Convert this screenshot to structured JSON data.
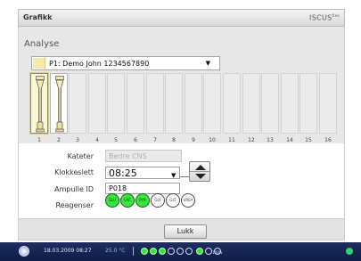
{
  "window": {
    "title": "Grafikk",
    "brand": "ISCUS",
    "brand_suffix": "flex"
  },
  "analyse": {
    "section_label": "Analyse",
    "patient_select": {
      "value": "P1: Demo John 1234567890"
    },
    "slots": [
      {
        "number": "1",
        "state": "selected",
        "has_vial": true
      },
      {
        "number": "2",
        "state": "active",
        "has_vial": true
      },
      {
        "number": "3",
        "state": "empty",
        "has_vial": false
      },
      {
        "number": "4",
        "state": "empty",
        "has_vial": false
      },
      {
        "number": "5",
        "state": "empty",
        "has_vial": false
      },
      {
        "number": "6",
        "state": "empty",
        "has_vial": false
      },
      {
        "number": "7",
        "state": "empty",
        "has_vial": false
      },
      {
        "number": "8",
        "state": "empty",
        "has_vial": false
      },
      {
        "number": "9",
        "state": "empty",
        "has_vial": false
      },
      {
        "number": "10",
        "state": "empty",
        "has_vial": false
      },
      {
        "number": "11",
        "state": "empty",
        "has_vial": false
      },
      {
        "number": "12",
        "state": "empty",
        "has_vial": false
      },
      {
        "number": "13",
        "state": "empty",
        "has_vial": false
      },
      {
        "number": "14",
        "state": "empty",
        "has_vial": false
      },
      {
        "number": "15",
        "state": "empty",
        "has_vial": false
      },
      {
        "number": "16",
        "state": "empty",
        "has_vial": false
      }
    ]
  },
  "form": {
    "kateter_label": "Kateter",
    "kateter_value": "Bedre CNS",
    "klokkeslett_label": "Klokkeslett",
    "klokkeslett_value": "08:25",
    "ampulle_label": "Ampulle ID",
    "ampulle_value": "P018",
    "reagenser_label": "Reagenser",
    "reagents": [
      {
        "code": "GLU",
        "active": true
      },
      {
        "code": "LAC",
        "active": true
      },
      {
        "code": "PYR",
        "active": true
      },
      {
        "code": "GLY",
        "active": false
      },
      {
        "code": "GLT",
        "active": false
      },
      {
        "code": "UREA",
        "active": false
      }
    ]
  },
  "footer": {
    "close_label": "Lukk"
  },
  "taskbar": {
    "datetime": "18.03.2009 08:27",
    "temperature": "25.0 °C",
    "indicators": [
      true,
      true,
      true,
      false,
      false,
      false,
      true,
      false,
      false
    ],
    "percent_label": "100%"
  },
  "colors": {
    "reagent_active": "#39e53c",
    "selected_slot": "#fbf8d6",
    "taskbar": "#1f2e60"
  },
  "icons": {
    "patient_swatch": "patient-color-swatch",
    "dropdown_arrow": "triangle-down-icon",
    "vial": "vial-icon",
    "stepper_up": "triangle-up-icon",
    "stepper_down": "triangle-down-icon",
    "start": "start-orb-icon"
  }
}
